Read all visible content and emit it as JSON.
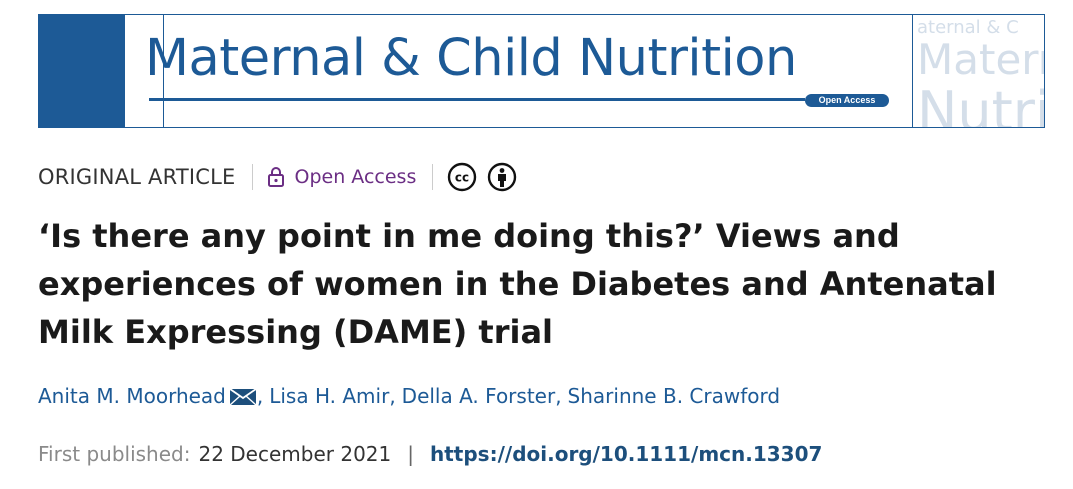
{
  "banner": {
    "journal_title": "Maternal & Child Nutrition",
    "open_access_badge": "Open Access",
    "ghost_line_1": "aternal & C",
    "ghost_line_2": "Matern",
    "ghost_line_3": "Nutri",
    "brand_color": "#1d5a96"
  },
  "meta": {
    "article_type": "ORIGINAL ARTICLE",
    "open_access_label": "Open Access",
    "open_access_color": "#6b2e84",
    "icons": [
      "lock-icon",
      "creative-commons-icon",
      "attribution-icon"
    ]
  },
  "article": {
    "title_line_1": "‘Is there any point in me doing this?’ Views and",
    "title_line_2": "experiences of women in the Diabetes and Antenatal",
    "title_line_3": "Milk Expressing (DAME) trial"
  },
  "authors": [
    {
      "name": "Anita M. Moorhead",
      "corresponding": true
    },
    {
      "name": "Lisa H. Amir"
    },
    {
      "name": "Della A. Forster"
    },
    {
      "name": "Sharinne B. Crawford"
    }
  ],
  "author_separator": ",",
  "publication": {
    "label": "First published:",
    "date": "22 December 2021",
    "separator": "|",
    "doi": "https://doi.org/10.1111/mcn.13307"
  }
}
